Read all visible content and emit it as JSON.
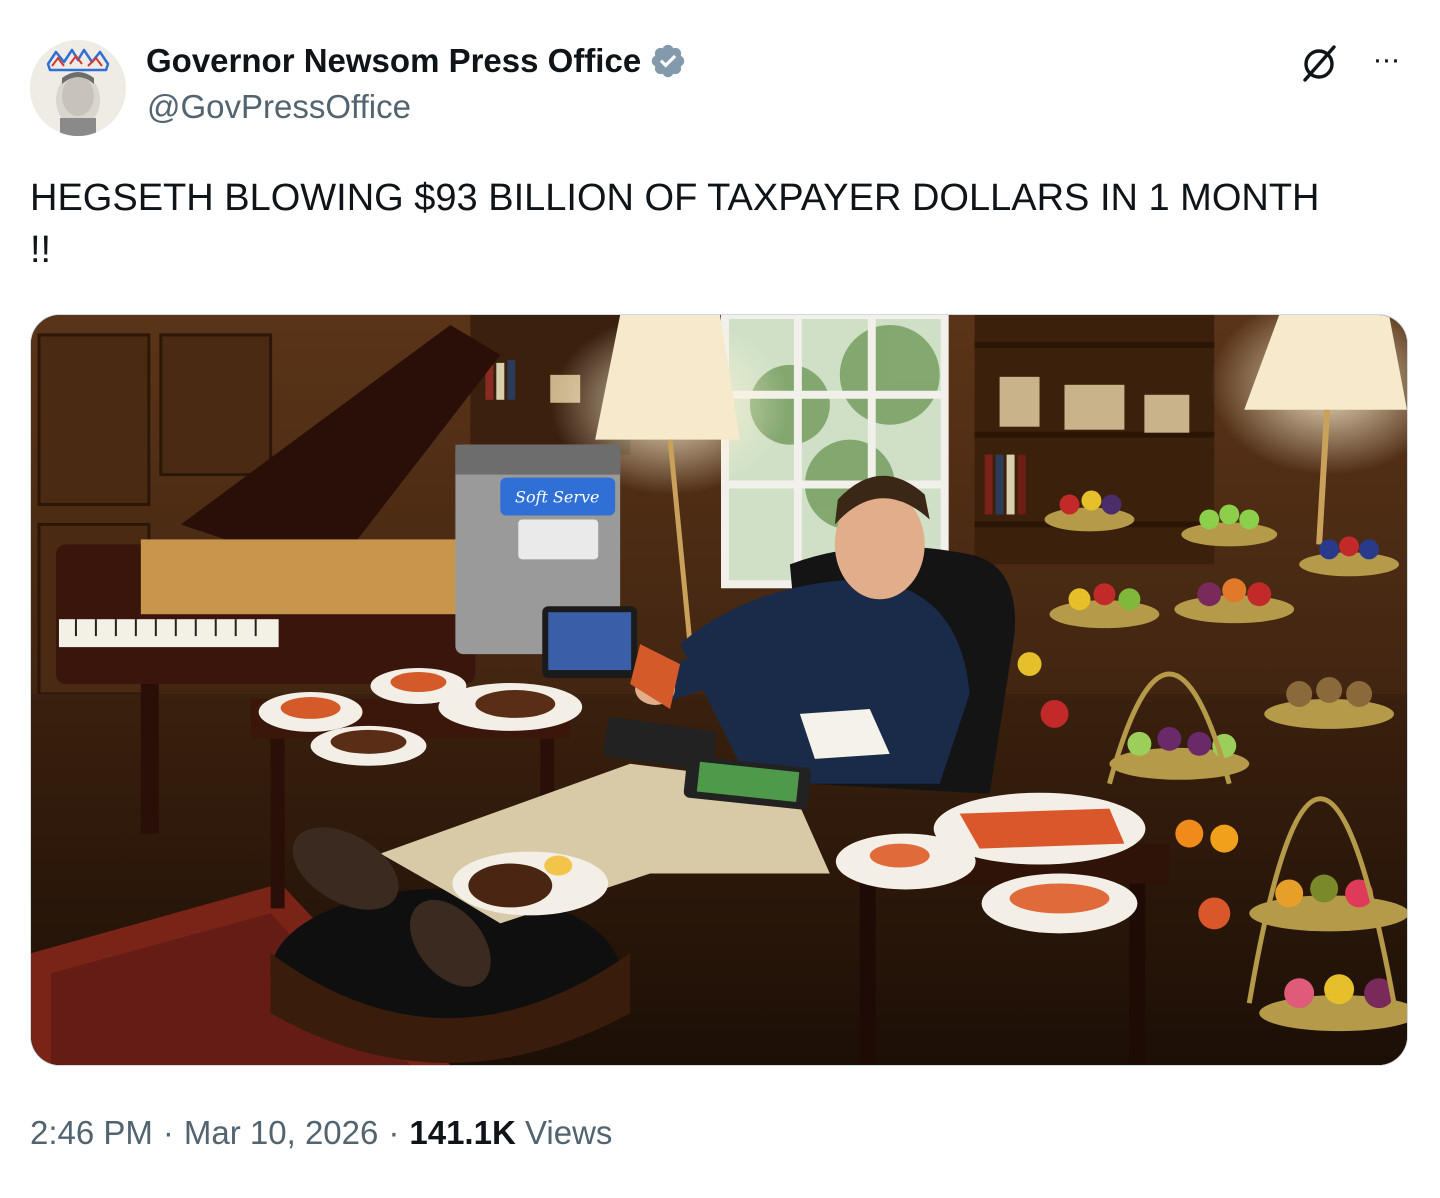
{
  "author": {
    "display_name": "Governor Newsom Press Office",
    "handle": "@GovPressOffice",
    "verified": true,
    "verified_color": "#829aab"
  },
  "tweet": {
    "text": "HEGSETH BLOWING $93 BILLION OF TAXPAYER DOLLARS IN 1 MONTH\n!!"
  },
  "media": {
    "machine_sign": "Soft Serve"
  },
  "meta": {
    "time": "2:46 PM",
    "separator": "·",
    "date": "Mar 10, 2026",
    "views_count": "141.1K",
    "views_label": "Views"
  },
  "icons": {
    "avatar": "avatar-crown-portrait",
    "verified": "verified-badge-icon",
    "grok": "grok-slash-icon",
    "more": "more-ellipsis-icon"
  }
}
